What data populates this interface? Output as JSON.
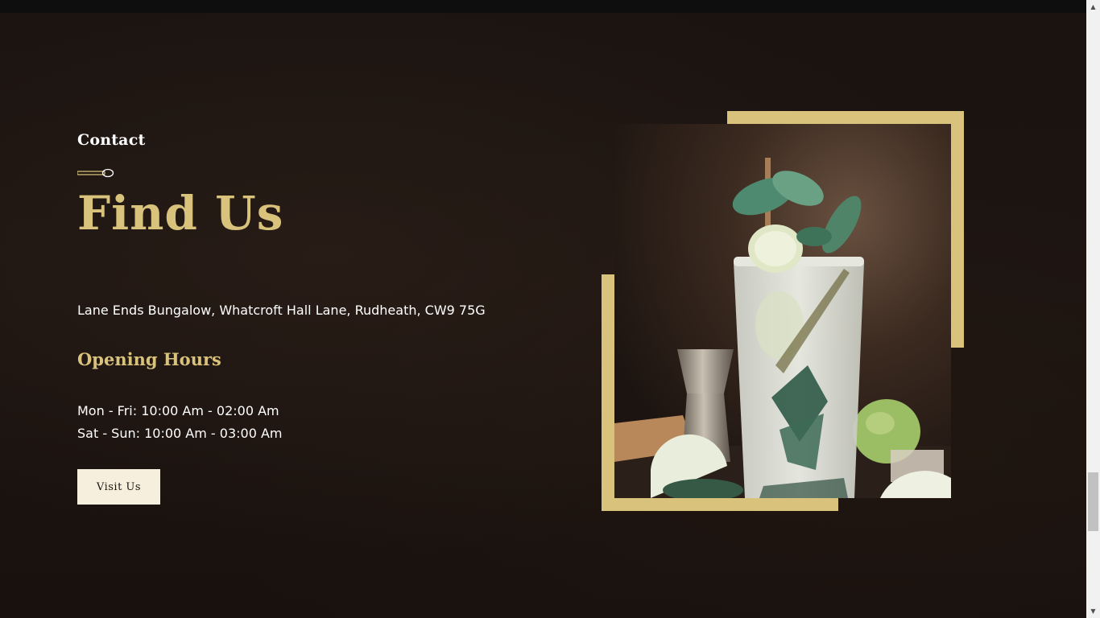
{
  "contact": {
    "eyebrow": "Contact",
    "heading": "Find Us",
    "address": "Lane Ends Bungalow, Whatcroft Hall Lane, Rudheath, CW9 75G",
    "hours_title": "Opening Hours",
    "hours": [
      "Mon - Fri: 10:00 Am - 02:00 Am",
      "Sat - Sun: 10:00 Am - 03:00 Am"
    ],
    "button_label": "Visit Us"
  },
  "colors": {
    "accent_gold": "#d8c27c",
    "background": "#1a1310",
    "button_bg": "#f6efdd",
    "text": "#ffffff"
  },
  "icons": {
    "divider": "spoon-icon",
    "scroll_up": "arrow-up-icon",
    "scroll_down": "arrow-down-icon"
  },
  "scrollbar": {
    "up_glyph": "▲",
    "down_glyph": "▼"
  }
}
